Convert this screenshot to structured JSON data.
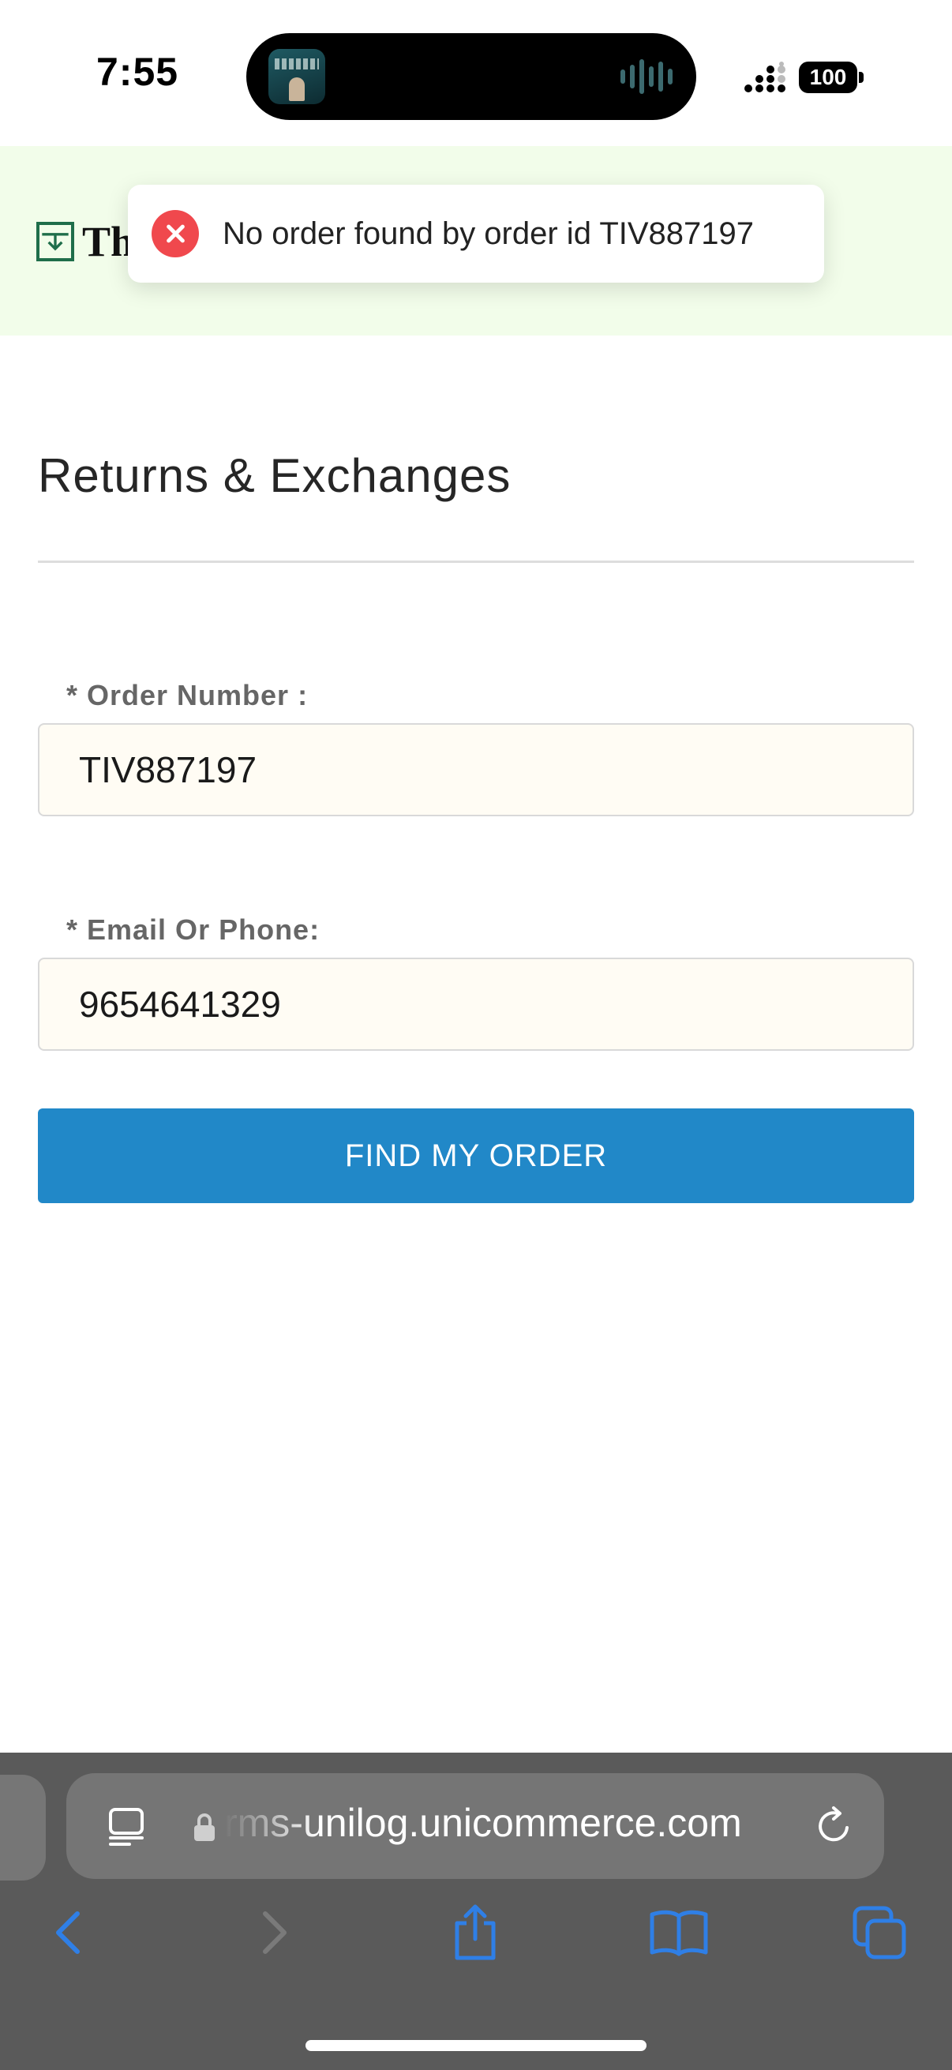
{
  "status_bar": {
    "time": "7:55",
    "battery": "100",
    "icons": [
      "cellular-signal-icon",
      "battery-icon"
    ],
    "now_playing": {
      "artwork": "album-art-icon",
      "activity": "audio-waveform-icon"
    }
  },
  "header": {
    "logo_text": "Th",
    "logo_icon": "brand-logo-icon"
  },
  "toast": {
    "icon": "error-circle-icon",
    "message": "No order found by order id TIV887197",
    "color": "#f0484d"
  },
  "form": {
    "title": "Returns & Exchanges",
    "order_number": {
      "label": "* Order Number :",
      "value": "TIV887197"
    },
    "email_or_phone": {
      "label": "* Email Or Phone:",
      "value": "9654641329"
    },
    "submit_label": "FIND MY ORDER",
    "submit_color": "#2188c8"
  },
  "browser": {
    "url": "rms-unilog.unicommerce.com",
    "icons": [
      "reader-mode-icon",
      "lock-icon",
      "reload-icon",
      "back-icon",
      "forward-icon",
      "share-icon",
      "bookmarks-icon",
      "tabs-icon"
    ]
  },
  "colors": {
    "header_bg": "#f2fdea",
    "input_bg": "#fffcf4",
    "toolbar_bg": "#5a5a5a",
    "toolbar_accent": "#2f7fe6"
  }
}
